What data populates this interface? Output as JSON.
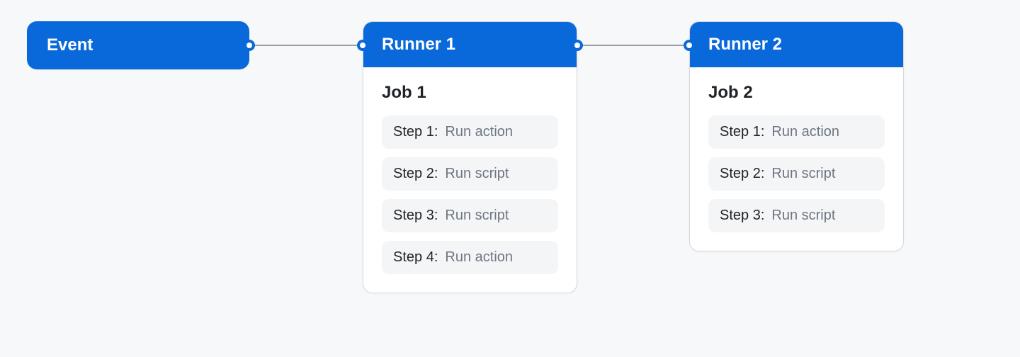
{
  "colors": {
    "accent": "#0969da",
    "background": "#f7f8fa",
    "cardBg": "#ffffff",
    "stepBg": "#f4f5f7",
    "textPrimary": "#1f2328",
    "textMuted": "#6e7781",
    "line": "#9ba0a8"
  },
  "event": {
    "label": "Event"
  },
  "runners": [
    {
      "title": "Runner 1",
      "job": {
        "title": "Job 1",
        "steps": [
          {
            "label": "Step 1:",
            "desc": "Run action"
          },
          {
            "label": "Step 2:",
            "desc": "Run script"
          },
          {
            "label": "Step 3:",
            "desc": "Run script"
          },
          {
            "label": "Step 4:",
            "desc": "Run action"
          }
        ]
      }
    },
    {
      "title": "Runner 2",
      "job": {
        "title": "Job 2",
        "steps": [
          {
            "label": "Step 1:",
            "desc": "Run action"
          },
          {
            "label": "Step 2:",
            "desc": "Run script"
          },
          {
            "label": "Step 3:",
            "desc": "Run script"
          }
        ]
      }
    }
  ]
}
